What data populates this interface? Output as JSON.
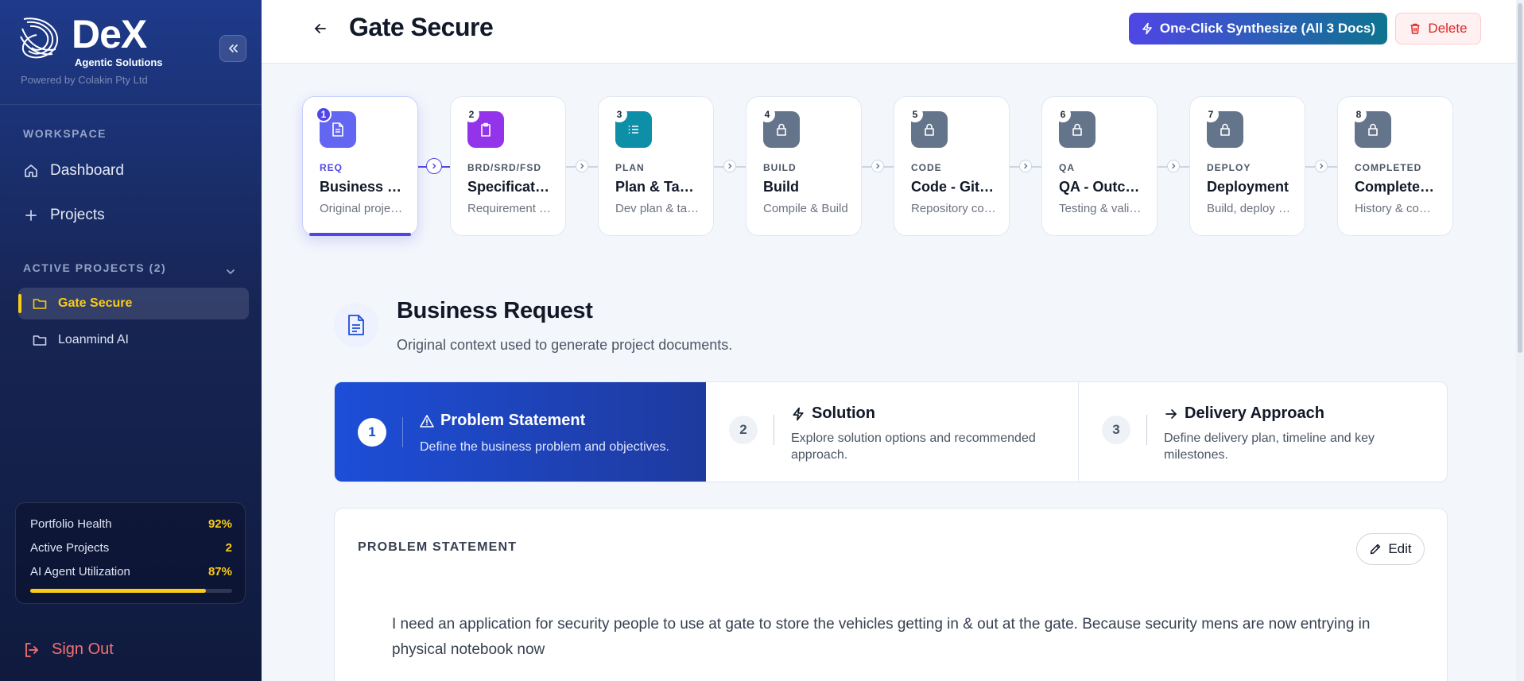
{
  "brand": {
    "name": "DeX",
    "subtitle": "Agentic Solutions",
    "powered_by": "Powered by Colakin Pty Ltd"
  },
  "sidebar": {
    "workspace_label": "WORKSPACE",
    "nav": [
      {
        "label": "Dashboard",
        "icon": "home-icon"
      },
      {
        "label": "Projects",
        "icon": "plus-icon"
      }
    ],
    "active_projects_label": "ACTIVE PROJECTS (2)",
    "projects": [
      {
        "label": "Gate Secure",
        "active": true
      },
      {
        "label": "Loanmind AI",
        "active": false
      }
    ],
    "stats": [
      {
        "label": "Portfolio Health",
        "value": "92%"
      },
      {
        "label": "Active Projects",
        "value": "2"
      },
      {
        "label": "AI Agent Utilization",
        "value": "87%"
      }
    ],
    "utilization_fraction": 0.87,
    "sign_out": "Sign Out"
  },
  "header": {
    "title": "Gate Secure",
    "synthesize_label": "One-Click Synthesize (All 3 Docs)",
    "delete_label": "Delete"
  },
  "steps": [
    {
      "num": "1",
      "code": "REQ",
      "name": "Business Request",
      "desc": "Original project context",
      "icon": "document-icon",
      "color": "#6366f1",
      "active": true
    },
    {
      "num": "2",
      "code": "BRD/SRD/FSD",
      "name": "Specifications",
      "desc": "Requirement documents",
      "icon": "clipboard-icon",
      "color": "#9333ea",
      "active": false
    },
    {
      "num": "3",
      "code": "PLAN",
      "name": "Plan & Tasks",
      "desc": "Dev plan & tasks",
      "icon": "list-icon",
      "color": "#0e8fa8",
      "active": false
    },
    {
      "num": "4",
      "code": "BUILD",
      "name": "Build",
      "desc": "Compile & Build",
      "icon": "lock-icon",
      "color": "#64748b",
      "active": false
    },
    {
      "num": "5",
      "code": "CODE",
      "name": "Code - GitHub",
      "desc": "Repository code",
      "icon": "lock-icon",
      "color": "#64748b",
      "active": false
    },
    {
      "num": "6",
      "code": "QA",
      "name": "QA - Outcomes",
      "desc": "Testing & validation",
      "icon": "lock-icon",
      "color": "#64748b",
      "active": false
    },
    {
      "num": "7",
      "code": "DEPLOY",
      "name": "Deployment",
      "desc": "Build, deploy & release",
      "icon": "lock-icon",
      "color": "#64748b",
      "active": false
    },
    {
      "num": "8",
      "code": "COMPLETED",
      "name": "Completed Tasks",
      "desc": "History & completed work",
      "icon": "lock-icon",
      "color": "#64748b",
      "active": false
    }
  ],
  "business_request": {
    "title": "Business Request",
    "subtitle": "Original context used to generate project documents."
  },
  "tabs": [
    {
      "num": "1",
      "title": "Problem Statement",
      "desc": "Define the business problem and objectives.",
      "icon": "warning-icon",
      "active": true
    },
    {
      "num": "2",
      "title": "Solution",
      "desc": "Explore solution options and recommended approach.",
      "icon": "bolt-icon",
      "active": false
    },
    {
      "num": "3",
      "title": "Delivery Approach",
      "desc": "Define delivery plan, timeline and key milestones.",
      "icon": "arrow-right-icon",
      "active": false
    }
  ],
  "problem": {
    "heading": "PROBLEM STATEMENT",
    "edit_label": "Edit",
    "text": "I need an application for security people to use at gate to store the vehicles getting in & out at the gate. Because security mens are now entrying in physical notebook now"
  }
}
